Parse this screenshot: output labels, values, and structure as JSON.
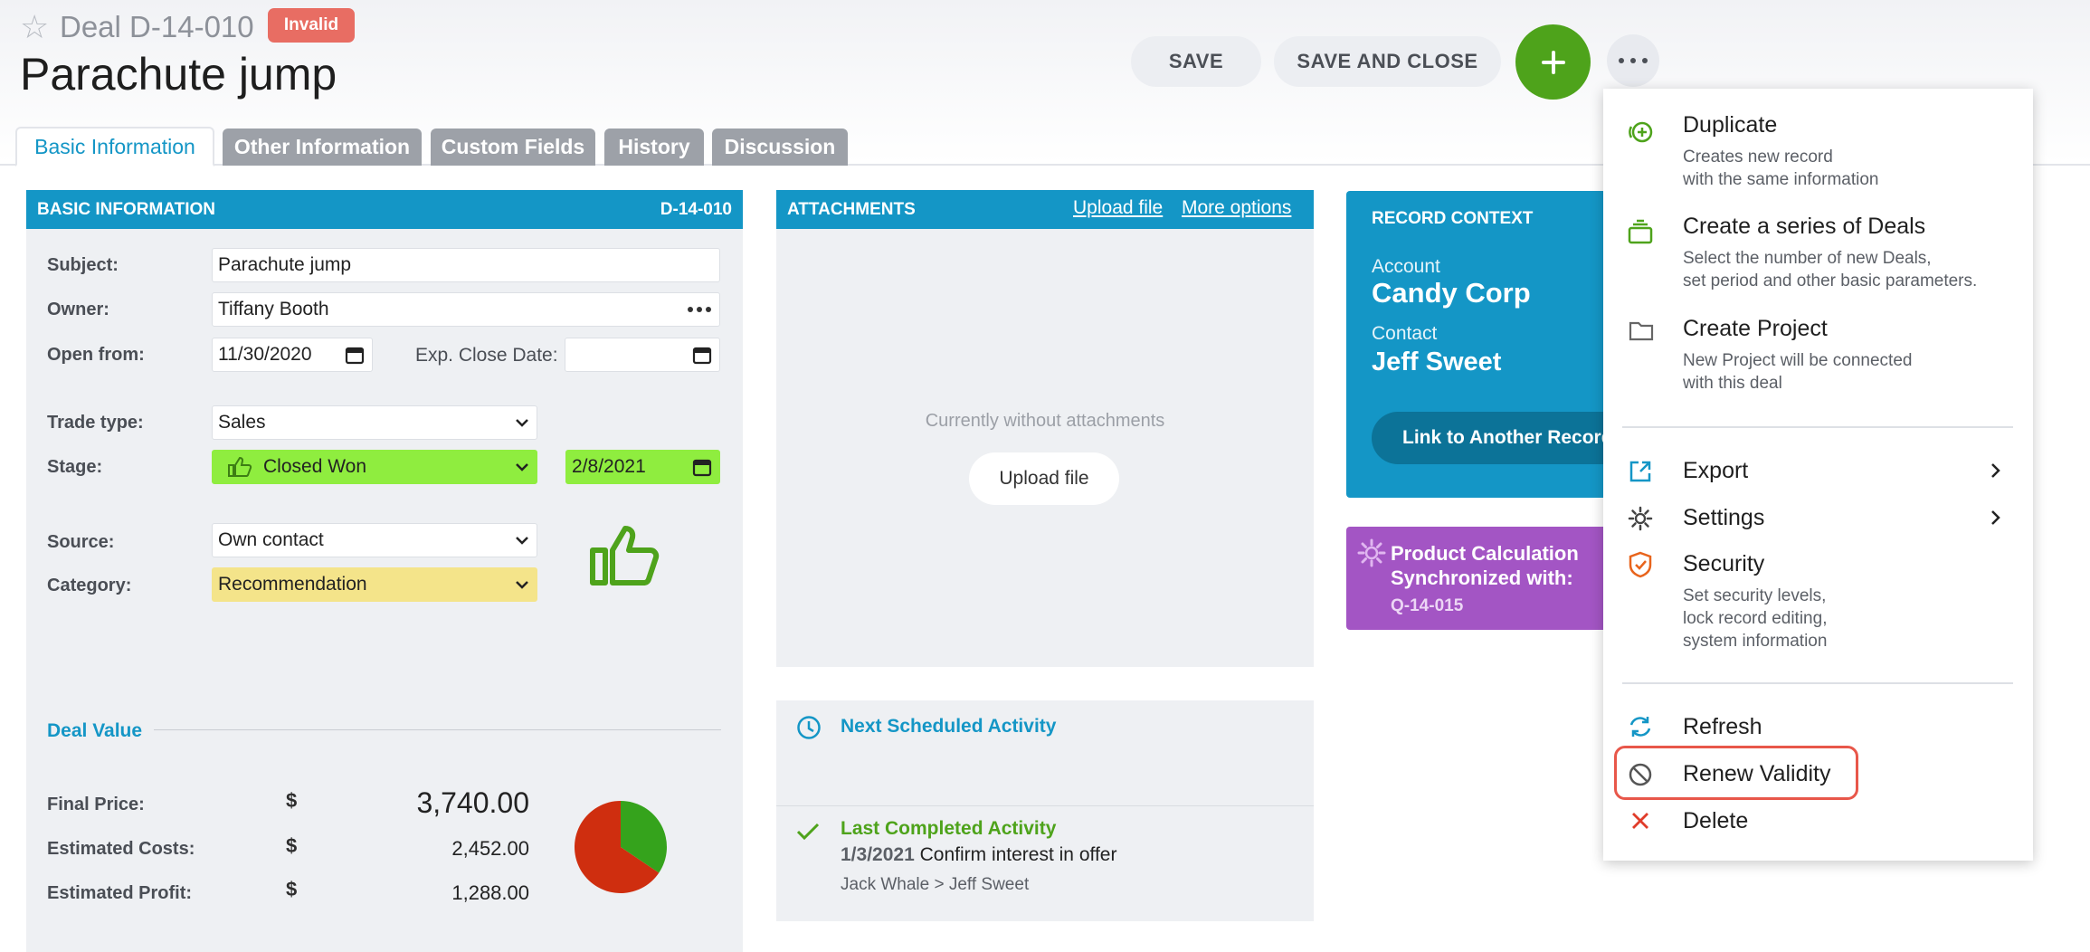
{
  "header": {
    "record_type": "Deal",
    "record_id": "D-14-010",
    "status_badge": "Invalid",
    "title": "Parachute jump"
  },
  "toolbar": {
    "save": "SAVE",
    "save_close": "SAVE AND CLOSE"
  },
  "tabs": [
    "Basic Information",
    "Other Information",
    "Custom Fields",
    "History",
    "Discussion"
  ],
  "basic": {
    "header": "BASIC INFORMATION",
    "id": "D-14-010",
    "subject_label": "Subject:",
    "subject": "Parachute jump",
    "owner_label": "Owner:",
    "owner": "Tiffany Booth",
    "open_label": "Open from:",
    "open": "11/30/2020",
    "close_label": "Exp. Close Date:",
    "close": "",
    "trade_label": "Trade type:",
    "trade": "Sales",
    "stage_label": "Stage:",
    "stage": "Closed Won",
    "stage_date": "2/8/2021",
    "source_label": "Source:",
    "source": "Own contact",
    "category_label": "Category:",
    "category": "Recommendation"
  },
  "deal_value": {
    "title": "Deal Value",
    "currency": "$",
    "rows": [
      {
        "label": "Final Price:",
        "value": "3,740.00"
      },
      {
        "label": "Estimated Costs:",
        "value": "2,452.00"
      },
      {
        "label": "Estimated Profit:",
        "value": "1,288.00"
      }
    ],
    "pie": {
      "costs": 2452,
      "profit": 1288,
      "costs_color": "#cf2e0f",
      "profit_color": "#35a31c"
    }
  },
  "attachments": {
    "header": "ATTACHMENTS",
    "upload_link": "Upload file",
    "more_link": "More options",
    "empty": "Currently without attachments",
    "upload_button": "Upload file"
  },
  "activities": {
    "next": "Next Scheduled Activity",
    "last": "Last Completed Activity",
    "last_date": "1/3/2021",
    "last_text": "Confirm interest in offer",
    "last_people": "Jack Whale > Jeff Sweet"
  },
  "context": {
    "header": "RECORD CONTEXT",
    "account_label": "Account",
    "account": "Candy Corp",
    "contact_label": "Contact",
    "contact": "Jeff Sweet",
    "link_button": "Link to Another Record"
  },
  "product_calc": {
    "line1": "Product Calculation",
    "line2": "Synchronized with:",
    "ref": "Q-14-015"
  },
  "menu": {
    "duplicate": {
      "title": "Duplicate",
      "d1": "Creates new record",
      "d2": "with the same information"
    },
    "series": {
      "title": "Create a series of Deals",
      "d1": "Select the number of new Deals,",
      "d2": "set period and other basic parameters."
    },
    "project": {
      "title": "Create Project",
      "d1": "New Project will be connected",
      "d2": "with this deal"
    },
    "export": "Export",
    "settings": "Settings",
    "security": {
      "title": "Security",
      "d1": "Set security levels,",
      "d2": "lock record editing,",
      "d3": "system information"
    },
    "refresh": "Refresh",
    "renew": "Renew Validity",
    "delete": "Delete"
  },
  "colors": {
    "accent": "#1496c6",
    "green": "#4ea31b",
    "invalid": "#e86d63",
    "highlight": "#e8574a",
    "stage_bg": "#8fed3f",
    "category_bg": "#f4e48a",
    "purple": "#a355c4"
  }
}
